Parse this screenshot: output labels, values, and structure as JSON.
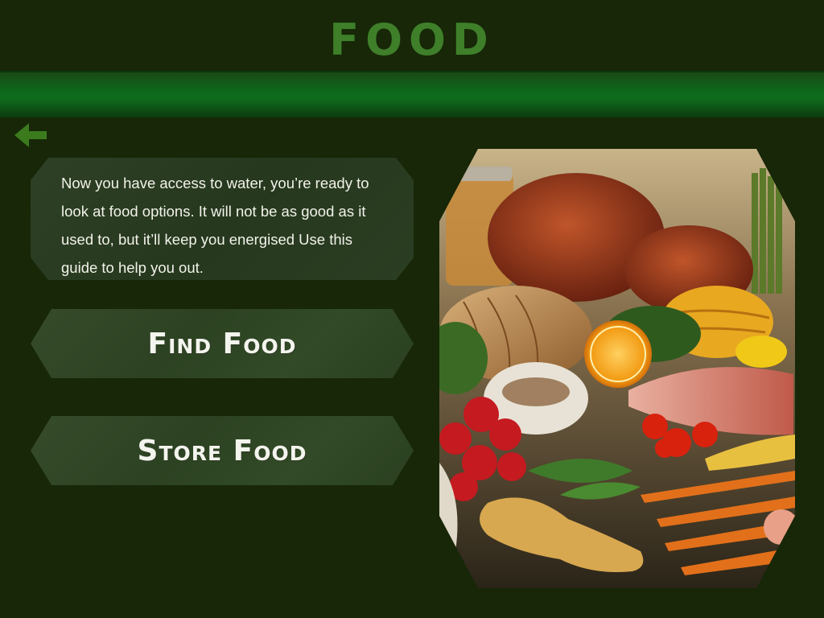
{
  "header": {
    "title": "FOOD"
  },
  "nav": {
    "back_icon": "arrow-left-icon"
  },
  "intro": {
    "text": "Now you have access to water, you’re ready to look at food options. It will not be as good as it used to, but it’ll keep you energised Use this guide to help you out."
  },
  "buttons": {
    "find_food": "Find Food",
    "store_food": "Store Food"
  },
  "image": {
    "subject": "food-still-life-photo"
  },
  "colors": {
    "background": "#172707",
    "title": "#3f7f2a",
    "bar": "#0d6a1d",
    "panel": "#2e4025",
    "text": "#f2f2ea"
  }
}
